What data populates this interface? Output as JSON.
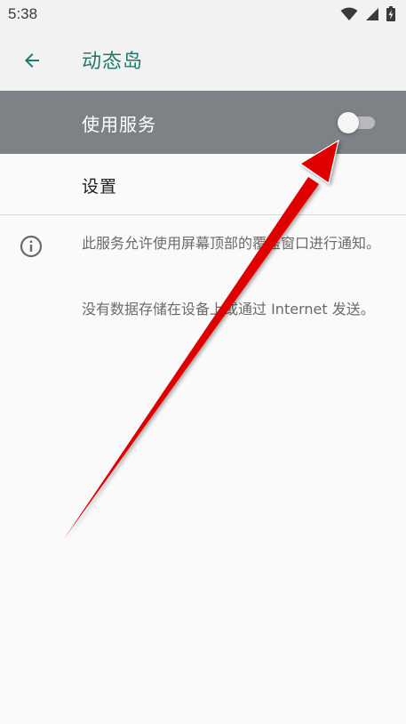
{
  "status_bar": {
    "time": "5:38",
    "icons": [
      "wifi-icon",
      "cellular-signal-icon",
      "battery-charging-icon"
    ]
  },
  "toolbar": {
    "back_icon": "arrow-back-icon",
    "title": "动态岛",
    "accent_color": "#1f7a6d"
  },
  "master_switch": {
    "label": "使用服务",
    "checked": false,
    "background_color": "#7e8186"
  },
  "settings": {
    "label": "设置"
  },
  "info": {
    "icon": "info-icon",
    "description": "此服务允许使用屏幕顶部的覆盖窗口进行通知。",
    "privacy_note": "没有数据存储在设备上或通过 Internet 发送。"
  },
  "annotation": {
    "type": "red-arrow",
    "color": "#e00000"
  }
}
